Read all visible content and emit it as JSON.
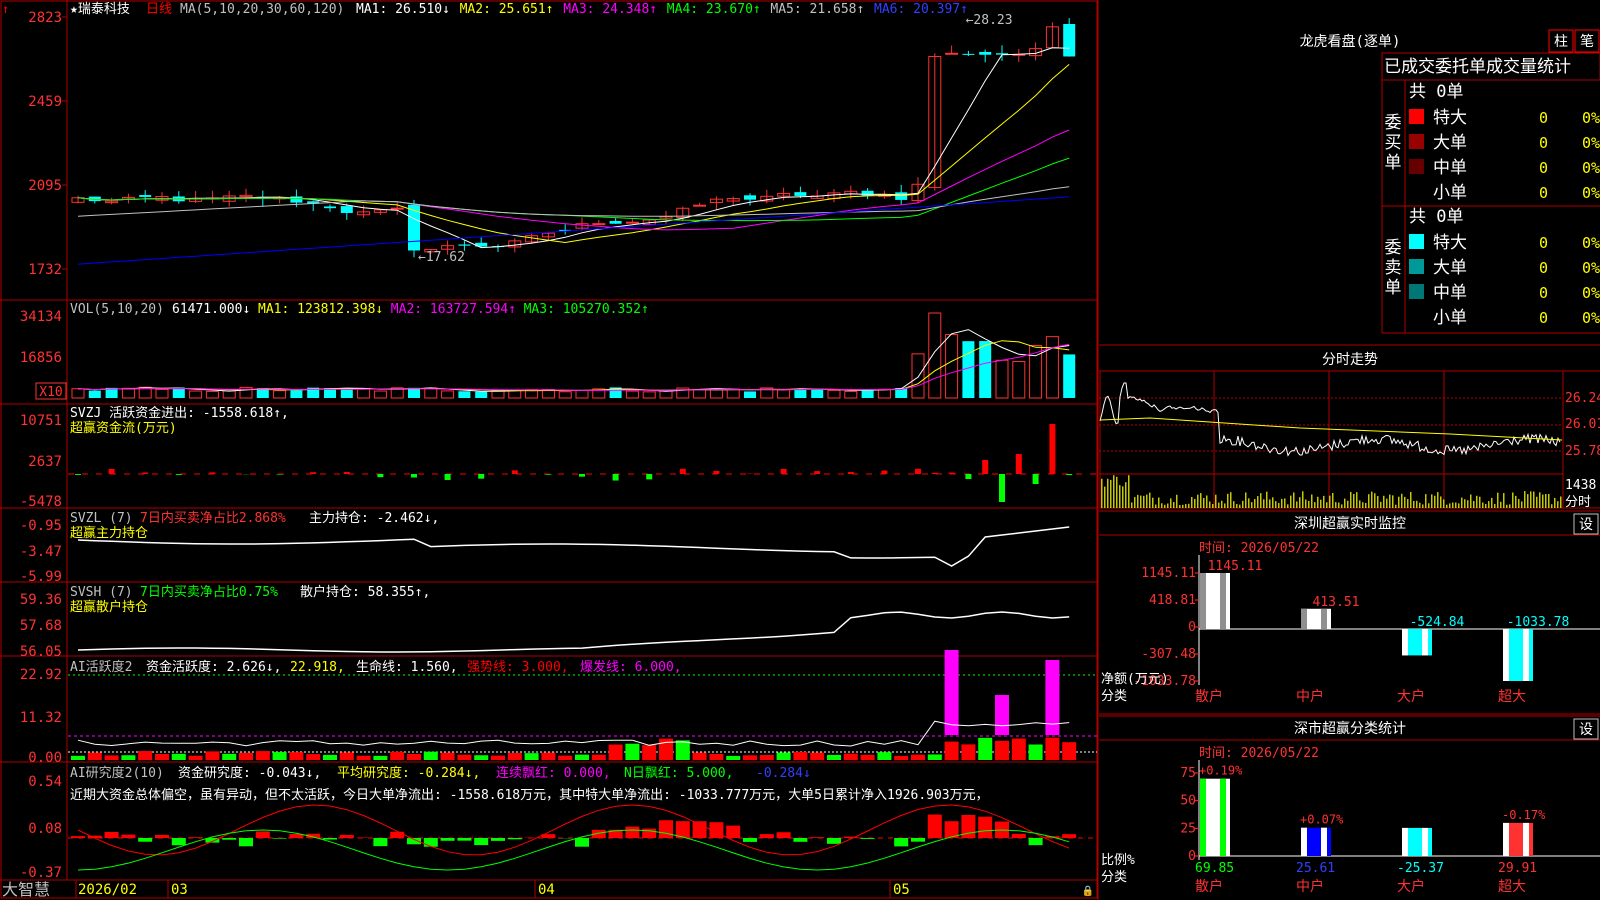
{
  "stock": {
    "star": "★",
    "name": "瑞泰科技",
    "period": "日线"
  },
  "ma_legend": {
    "prefix": "MA(5,10,20,30,60,120)",
    "items": [
      {
        "label": "MA1:",
        "value": "26.510",
        "arrow": "↓",
        "color": "#ffffff"
      },
      {
        "label": "MA2:",
        "value": "25.651",
        "arrow": "↑",
        "color": "#ffff00"
      },
      {
        "label": "MA3:",
        "value": "24.348",
        "arrow": "↑",
        "color": "#ff00ff"
      },
      {
        "label": "MA4:",
        "value": "23.670",
        "arrow": "↑",
        "color": "#00ff00"
      },
      {
        "label": "MA5:",
        "value": "21.658",
        "arrow": "↑",
        "color": "#c0c0c0"
      },
      {
        "label": "MA6:",
        "value": "20.397",
        "arrow": "↑",
        "color": "#0000ff"
      }
    ]
  },
  "price_axis": [
    "2823",
    "2459",
    "2095",
    "1732"
  ],
  "price_marks": {
    "high": "28.23",
    "low": "17.62"
  },
  "vol_legend": {
    "prefix": "VOL(5,10,20)",
    "items": [
      {
        "label": "",
        "value": "61471.000",
        "arrow": "↓",
        "color": "#ffffff"
      },
      {
        "label": "MA1:",
        "value": "123812.398",
        "arrow": "↓",
        "color": "#ffff00"
      },
      {
        "label": "MA2:",
        "value": "163727.594",
        "arrow": "↑",
        "color": "#ff00ff"
      },
      {
        "label": "MA3:",
        "value": "105270.352",
        "arrow": "↑",
        "color": "#00ff00"
      }
    ]
  },
  "vol_axis": [
    "34134",
    "16856"
  ],
  "vol_unit": "X10",
  "svzj": {
    "line1": "SVZJ  活跃资金进出: -1558.618↑,",
    "line2": "超赢资金流(万元)",
    "axis": [
      "10751",
      "2637",
      "-5478"
    ]
  },
  "svzl": {
    "title": "SVZL (7)",
    "pct": "7日内买卖净占比2.868%",
    "hold": "主力持仓: -2.462↓,",
    "line2": "超赢主力持仓",
    "axis": [
      "-0.95",
      "-3.47",
      "-5.99"
    ]
  },
  "svsh": {
    "title": "SVSH (7)",
    "pct": "7日内买卖净占比0.75%",
    "hold": "散户持仓: 58.355↑,",
    "line2": "超赢散户持仓",
    "axis": [
      "59.36",
      "57.68",
      "56.05"
    ]
  },
  "ai_active": {
    "title": "AI活跃度2",
    "active": "资金活跃度: 2.626↓,",
    "v2": "22.918,",
    "life": "生命线: 1.560,",
    "strong": "强势线: 3.000,",
    "burst": "爆发线: 6.000,",
    "axis": [
      "22.92",
      "11.32",
      "0.00"
    ]
  },
  "ai_research": {
    "title": "AI研究度2(10)",
    "r1": "资金研究度: -0.043↓,",
    "r2": "平均研究度: -0.284↓,",
    "r3": "连续飘红: 0.000,",
    "r4": "N日飘红: 5.000,",
    "r5": "-0.284↓",
    "desc": "近期大资金总体偏空，虽有异动，但不太活跃，今日大单净流出: -1558.618万元，其中特大单净流出: -1033.777万元，大单5日累计净入1926.903万元，",
    "axis": [
      "0.54",
      "0.08",
      "-0.37"
    ]
  },
  "date_axis": {
    "start": "2026/02",
    "months": [
      "03",
      "04",
      "05"
    ]
  },
  "brand": "大智慧",
  "dragon": {
    "title": "龙虎看盘(逐单)",
    "btn_bar": "柱",
    "btn_detail": "笔",
    "tabs": [
      "已成交委托单成交量统计"
    ],
    "buy_label": "委买单",
    "sell_label": "委卖单",
    "buy_total": "共 0单",
    "sell_total": "共 0单",
    "buy_rows": [
      {
        "name": "特大",
        "count": "0",
        "pct": "0%",
        "color": "#ff0000"
      },
      {
        "name": "大单",
        "count": "0",
        "pct": "0%",
        "color": "#990000"
      },
      {
        "name": "中单",
        "count": "0",
        "pct": "0%",
        "color": "#660000"
      },
      {
        "name": "小单",
        "count": "0",
        "pct": "0%",
        "color": ""
      }
    ],
    "sell_rows": [
      {
        "name": "特大",
        "count": "0",
        "pct": "0%",
        "color": "#00ffff"
      },
      {
        "name": "大单",
        "count": "0",
        "pct": "0%",
        "color": "#009999"
      },
      {
        "name": "中单",
        "count": "0",
        "pct": "0%",
        "color": "#007777"
      },
      {
        "name": "小单",
        "count": "0",
        "pct": "0%",
        "color": ""
      }
    ]
  },
  "intraday": {
    "title": "分时走势",
    "axis": [
      "26.24",
      "26.01",
      "25.78"
    ],
    "vol": "1438",
    "vol_label": "分时"
  },
  "monitor": {
    "title": "深圳超赢实时监控",
    "btn": "设",
    "time": "时间: 2026/05/22",
    "axis": [
      "1145.11",
      "418.81",
      "0",
      "-307.48",
      "-1033.78"
    ],
    "ylabel1": "净额(万元)",
    "ylabel2": "分类",
    "categories": [
      "散户",
      "中户",
      "大户",
      "超大"
    ],
    "values": [
      1145.11,
      413.51,
      -524.84,
      -1033.78
    ],
    "value_labels": [
      "1145.11",
      "413.51",
      "-524.84",
      "-1033.78"
    ]
  },
  "classify": {
    "title": "深市超赢分类统计",
    "btn": "设",
    "time": "时间: 2026/05/22",
    "axis": [
      "75",
      "50",
      "25",
      "0"
    ],
    "ylabel1": "比例%",
    "ylabel2": "分类",
    "categories": [
      "散户",
      "中户",
      "大户",
      "超大"
    ],
    "values": [
      69.85,
      25.61,
      -25.37,
      29.91
    ],
    "value_labels": [
      "69.85",
      "25.61",
      "-25.37",
      "29.91"
    ],
    "changes": [
      "+0.19%",
      "+0.07%",
      "",
      "-0.17%"
    ]
  },
  "colors": {
    "up": "#ff3232",
    "down": "#00ffff",
    "grid": "#b00000",
    "text": "#c0c0c0"
  }
}
